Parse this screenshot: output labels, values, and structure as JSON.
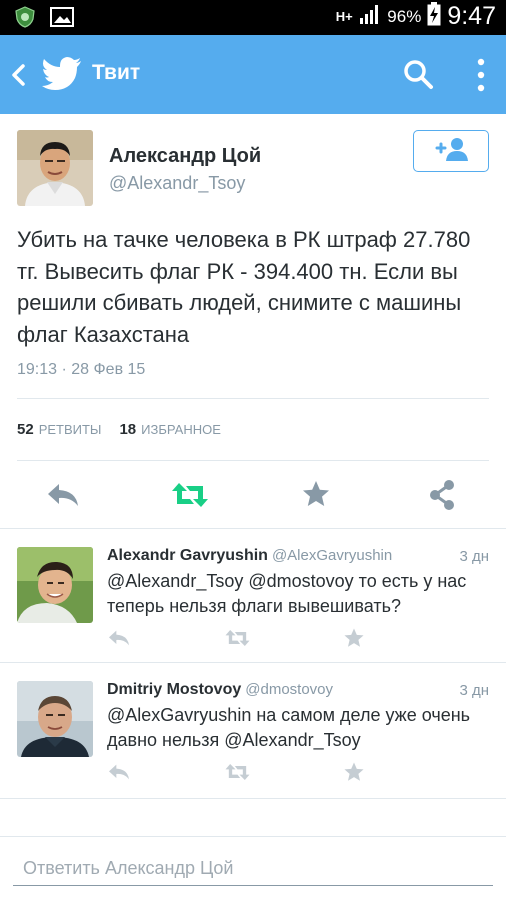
{
  "statusbar": {
    "left_icons": [
      "shield-app-icon",
      "gallery-icon"
    ],
    "network": "H+",
    "battery": "96%",
    "time": "9:47"
  },
  "appbar": {
    "title": "Твит",
    "background": "#55acee"
  },
  "tweet": {
    "author_name": "Александр Цой",
    "author_handle": "@Alexandr_Tsoy",
    "text": "Убить на тачке человека в РК штраф 27.780 тг. Вывесить флаг РК - 394.400 тн. Если вы решили сбивать людей, снимите с машины флаг Казахстана",
    "timestamp": "19:13 · 28 Фев 15",
    "retweets_count": "52",
    "retweets_label": "РЕТВИТЫ",
    "favorites_count": "18",
    "favorites_label": "ИЗБРАННОЕ"
  },
  "actions": {
    "icons": [
      "reply-icon",
      "retweet-icon",
      "favorite-icon",
      "share-icon"
    ],
    "retweet_color": "#19cf86"
  },
  "replies": [
    {
      "name": "Alexandr Gavryushin",
      "handle": "@AlexGavryushin",
      "time": "3 дн",
      "text": "@Alexandr_Tsoy @dmostovoy то есть у нас теперь нельзя флаги вывешивать?"
    },
    {
      "name": "Dmitriy Mostovoy",
      "handle": "@dmostovoy",
      "time": "3 дн",
      "text": "@AlexGavryushin на самом деле уже очень давно нельзя @Alexandr_Tsoy"
    }
  ],
  "compose": {
    "placeholder": "Ответить Александр Цой"
  }
}
